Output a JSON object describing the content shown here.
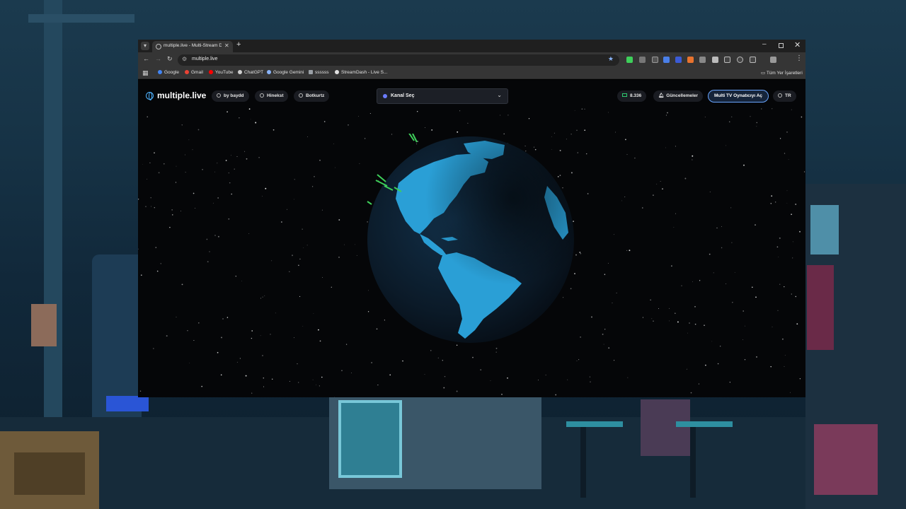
{
  "browser": {
    "tab_title": "multiple.live - Multi-Stream De",
    "url": "multiple.live",
    "bookmarks": [
      {
        "label": "Google",
        "color": "#4285f4"
      },
      {
        "label": "Gmail",
        "color": "#ea4335"
      },
      {
        "label": "YouTube",
        "color": "#ff0000"
      },
      {
        "label": "ChatGPT",
        "color": "#cfcfcf"
      },
      {
        "label": "Google Gemini",
        "color": "#8ab4f8"
      },
      {
        "label": "ssssss",
        "color": "#9aa0a6"
      },
      {
        "label": "StreamDash - Live S...",
        "color": "#e0e0e0"
      }
    ],
    "bookmarks_folder": "Tüm Yer İşaretleri"
  },
  "site": {
    "logo": "multiple.live",
    "nav": {
      "by": "by baydd",
      "link1": "Hinekst",
      "link2": "Botkurtz"
    },
    "channel_select": "Kanal Seç",
    "viewers": "8.336",
    "updates": "Güncellemeler",
    "cta": "Multi TV Oynatıcıyı Aç",
    "language": "TR"
  },
  "globe": {
    "ocean_color": "#0b1a28",
    "land_color": "#2a9fd6",
    "marker_color": "#3ecf5a"
  }
}
